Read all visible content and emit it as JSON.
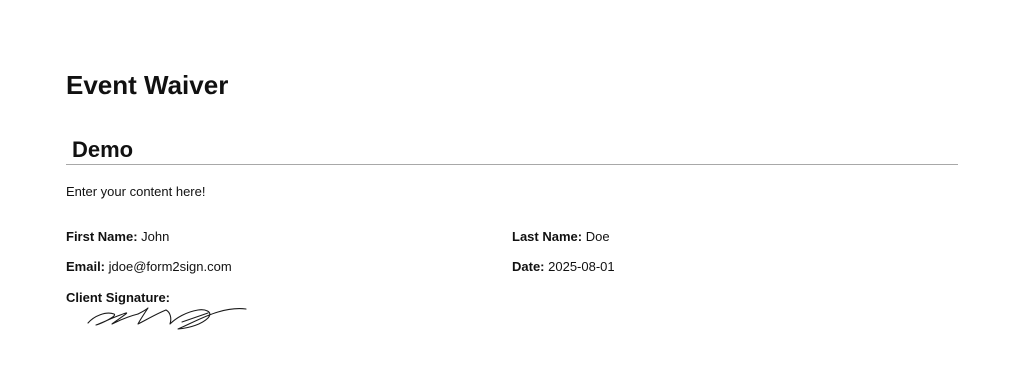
{
  "document": {
    "title": "Event Waiver"
  },
  "section": {
    "title": "Demo",
    "content": "Enter your content here!"
  },
  "fields": {
    "first_name": {
      "label": "First Name:",
      "value": "John"
    },
    "last_name": {
      "label": "Last Name:",
      "value": "Doe"
    },
    "email": {
      "label": "Email:",
      "value": "jdoe@form2sign.com"
    },
    "date": {
      "label": "Date:",
      "value": "2025-08-01"
    },
    "signature": {
      "label": "Client Signature:"
    }
  },
  "colors": {
    "text": "#111111",
    "divider": "#a8a8a8",
    "background": "#ffffff"
  }
}
